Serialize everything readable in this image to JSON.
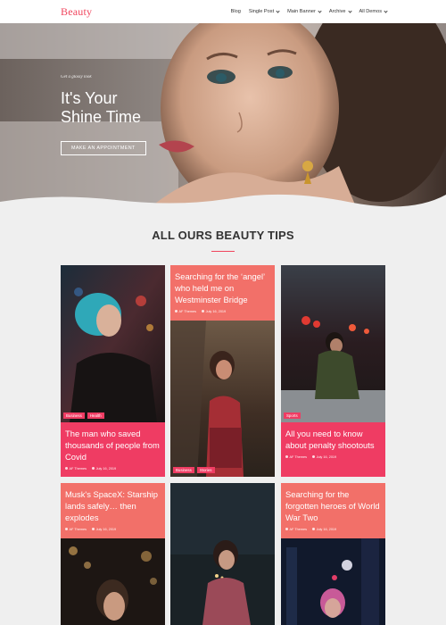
{
  "header": {
    "logo": "Beauty",
    "nav": [
      "Blog",
      "Single Post",
      "Main Banner",
      "Archive",
      "All Demos"
    ]
  },
  "hero": {
    "tagline": "Get a glossy look",
    "title_line1": "It's Your",
    "title_line2": "Shine Time",
    "button": "MAKE AN APPOINTMENT"
  },
  "section": {
    "title": "ALL OURS BEAUTY TIPS"
  },
  "cards": [
    {
      "title": "The man who saved thousands of people from Covid",
      "author": "AF Themes",
      "date": "July 16, 2019",
      "tags": [
        "Business",
        "Health"
      ]
    },
    {
      "title": "Searching for the ‘angel’ who held me on Westminster Bridge",
      "author": "AF Themes",
      "date": "July 16, 2019",
      "tags": [
        "Business",
        "Stories"
      ]
    },
    {
      "title": "All you need to know about penalty shootouts",
      "author": "AF Themes",
      "date": "July 16, 2019",
      "tags": [
        "Sports"
      ]
    },
    {
      "title": "Musk's SpaceX: Starship lands safely… then explodes",
      "author": "AF Themes",
      "date": "July 16, 2019",
      "tags": []
    },
    {
      "title": "",
      "author": "",
      "date": "",
      "tags": []
    },
    {
      "title": "Searching for the forgotten heroes of World War Two",
      "author": "AF Themes",
      "date": "July 16, 2019",
      "tags": []
    }
  ],
  "colors": {
    "accent": "#f0455d",
    "card_pink": "#ef3c63",
    "card_salmon": "#f27069",
    "page_bg": "#efefef"
  }
}
